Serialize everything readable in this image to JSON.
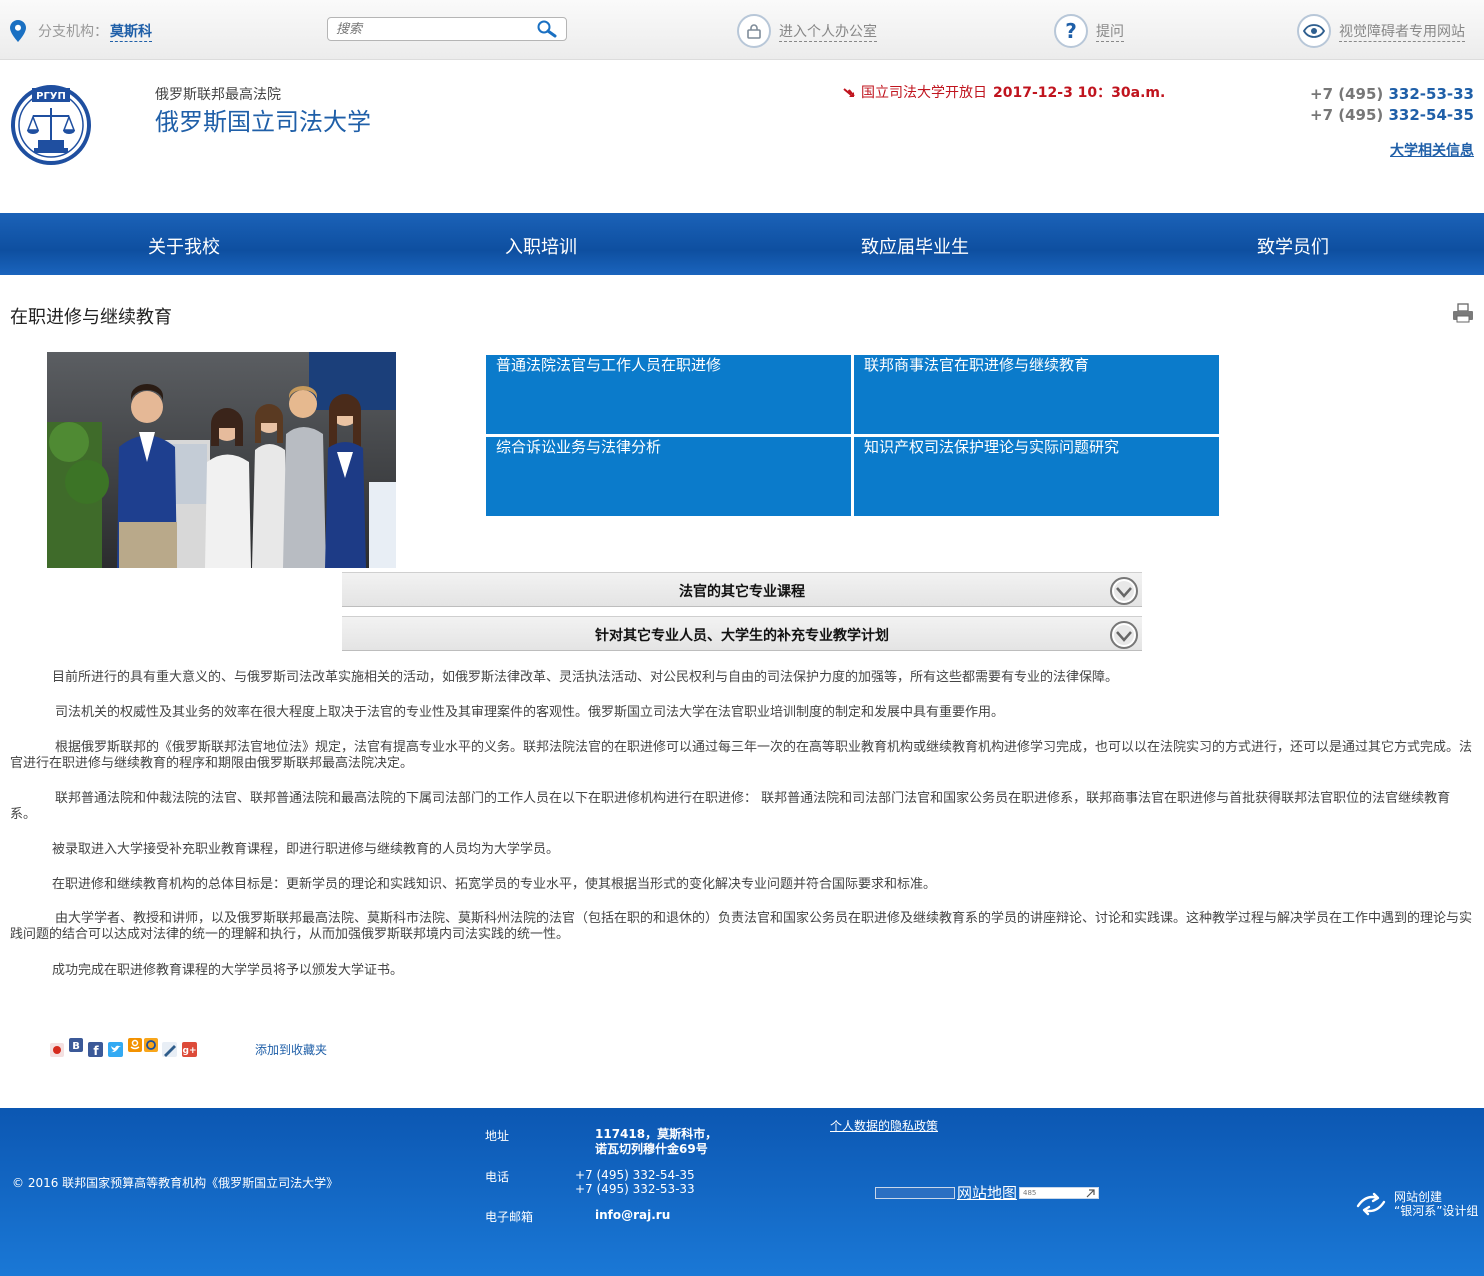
{
  "topbar": {
    "branch_label": "分支机构：",
    "branch_value": "莫斯科",
    "search_placeholder": "搜索",
    "office_link": "进入个人办公室",
    "question_link": "提问",
    "visually_impaired_link": "视觉障碍者专用网站"
  },
  "header": {
    "logo_text": "РГУП",
    "org_subtitle": "俄罗斯联邦最高法院",
    "org_title": "俄罗斯国立司法大学",
    "announcement": "国立司法大学开放日",
    "announcement_date": "2017-12-3 10：30a.m.",
    "phone_prefix_1": "+7 (495)",
    "phone_number_1": "332-53-33",
    "phone_prefix_2": "+7 (495)",
    "phone_number_2": "332-54-35",
    "university_info_link": "大学相关信息"
  },
  "nav": {
    "items": [
      "关于我校",
      "入职培训",
      "致应届毕业生",
      "致学员们"
    ]
  },
  "page": {
    "title": "在职进修与继续教育"
  },
  "tiles": [
    "普通法院法官与工作人员在职进修",
    "联邦商事法官在职进修与继续教育",
    "综合诉讼业务与法律分析",
    "知识产权司法保护理论与实际问题研究"
  ],
  "accordions": [
    "法官的其它专业课程",
    "针对其它专业人员、大学生的补充专业教学计划"
  ],
  "paragraphs": [
    "目前所进行的具有重大意义的、与俄罗斯司法改革实施相关的活动，如俄罗斯法律改革、灵活执法活动、对公民权利与自由的司法保护力度的加强等，所有这些都需要有专业的法律保障。",
    "司法机关的权威性及其业务的效率在很大程度上取决于法官的专业性及其审理案件的客观性。俄罗斯国立司法大学在法官职业培训制度的制定和发展中具有重要作用。",
    "根据俄罗斯联邦的《俄罗斯联邦法官地位法》规定，法官有提高专业水平的义务。联邦法院法官的在职进修可以通过每三年一次的在高等职业教育机构或继续教育机构进修学习完成，也可以以在法院实习的方式进行，还可以是通过其它方式完成。法官进行在职进修与继续教育的程序和期限由俄罗斯联邦最高法院决定。",
    "联邦普通法院和仲裁法院的法官、联邦普通法院和最高法院的下属司法部门的工作人员在以下在职进修机构进行在职进修：  联邦普通法院和司法部门法官和国家公务员在职进修系，联邦商事法官在职进修与首批获得联邦法官职位的法官继续教育系。",
    "被录取进入大学接受补充职业教育课程，即进行职进修与继续教育的人员均为大学学员。",
    "在职进修和继续教育机构的总体目标是：更新学员的理论和实践知识、拓宽学员的专业水平，使其根据当形式的变化解决专业问题并符合国际要求和标准。",
    "由大学学者、教授和讲师，以及俄罗斯联邦最高法院、莫斯科市法院、莫斯科州法院的法官（包括在职的和退休的）负责法官和国家公务员在职进修及继续教育系的学员的讲座辩论、讨论和实践课。这种教学过程与解决学员在工作中遇到的理论与实践问题的结合可以达成对法律的统一的理解和执行，从而加强俄罗斯联邦境内司法实践的统一性。",
    "成功完成在职进修教育课程的大学学员将予以颁发大学证书。"
  ],
  "share": {
    "add_to_favorites": "添加到收藏夹"
  },
  "footer": {
    "copyright": "© 2016 联邦国家预算高等教育机构《俄罗斯国立司法大学》",
    "address_label": "地址",
    "address_line1": "117418，莫斯科市，",
    "address_line2": "诺瓦切列穆什金69号",
    "phone_label": "电话",
    "phone_1": "+7 (495) 332-54-35",
    "phone_2": "+7 (495) 332-53-33",
    "email_label": "电子邮箱",
    "email": "info@raj.ru",
    "privacy_link": "个人数据的隐私政策",
    "sitemap": "网站地图",
    "counter_text": "485",
    "credit_line1": "网站创建",
    "credit_line2": "“银河系”设计组"
  },
  "colors": {
    "brand_blue": "#1f5fa8",
    "tile_blue": "#0b7bcb",
    "accent_red": "#c0141e"
  }
}
